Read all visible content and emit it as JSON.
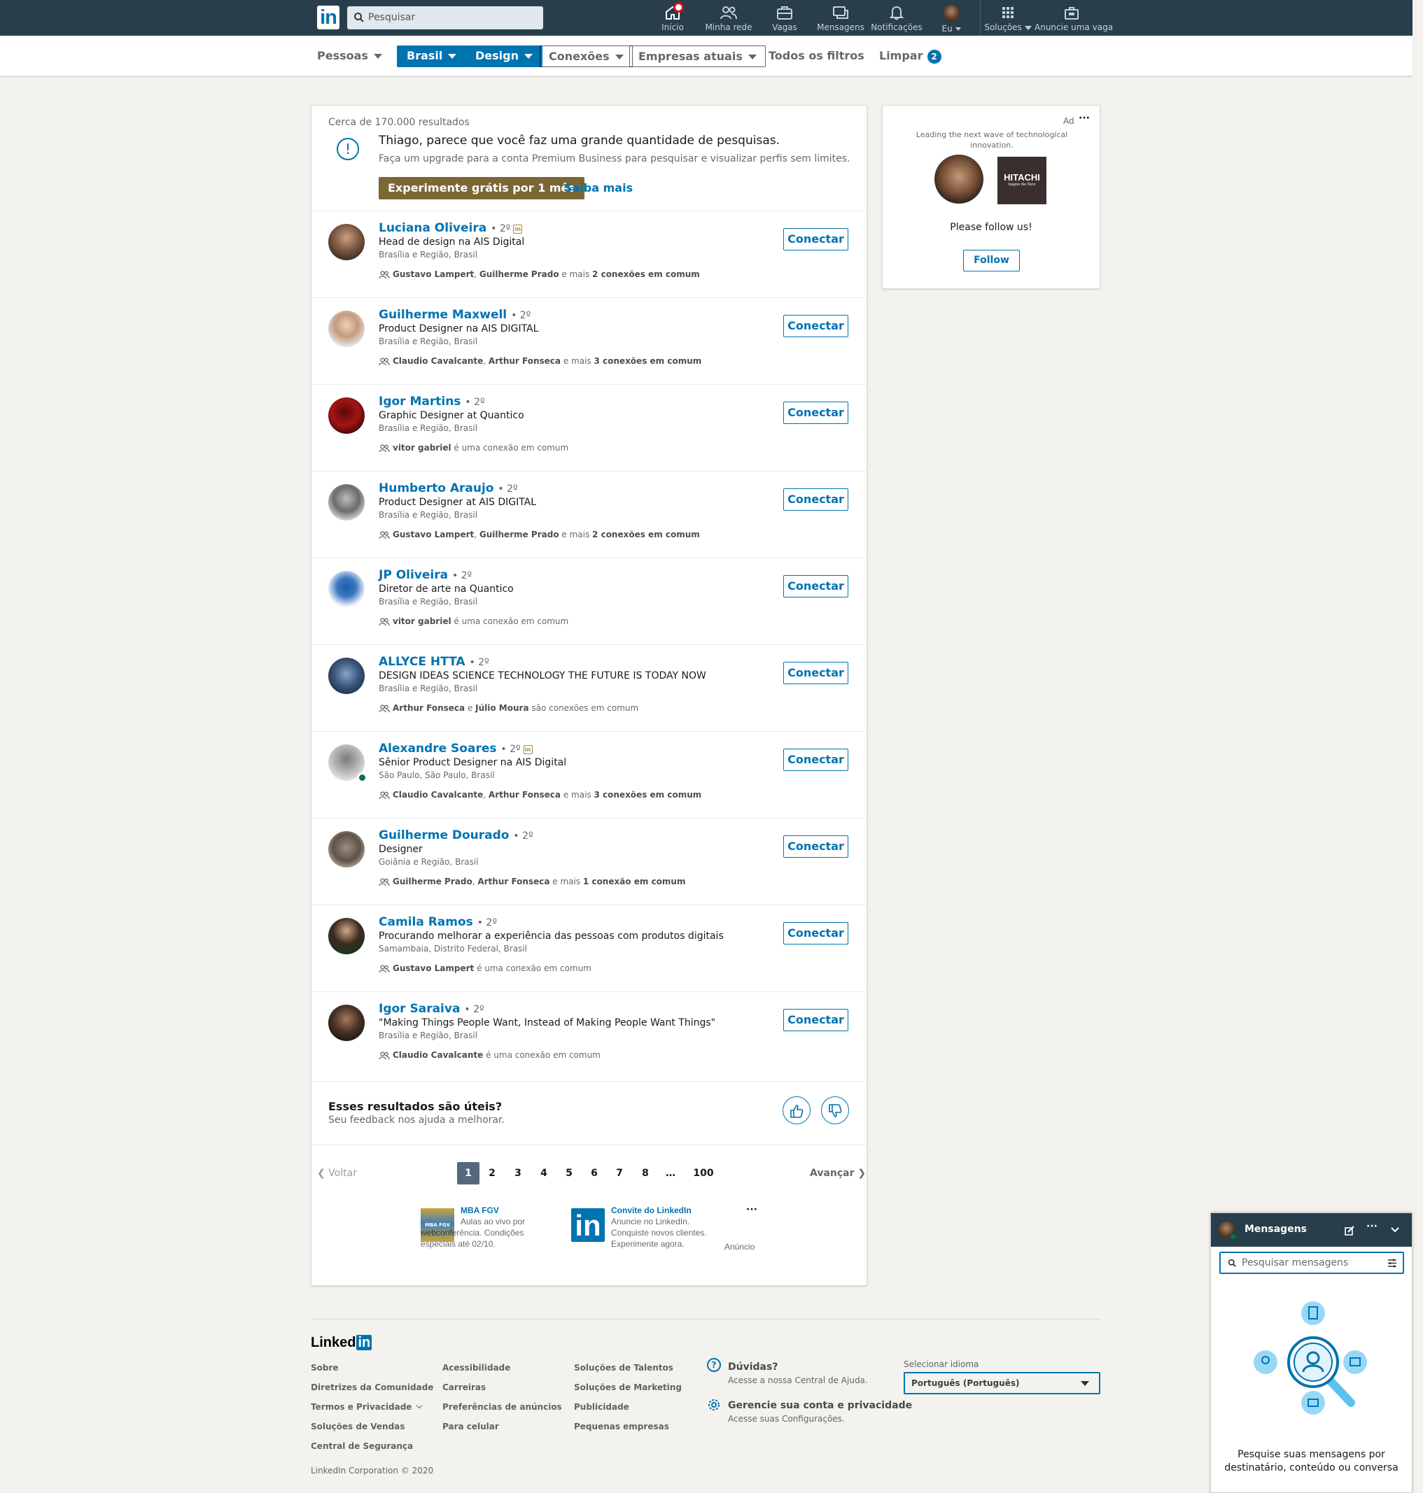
{
  "colors": {
    "nav": "#283e4a",
    "brand": "#0073b1",
    "premium": "#7a6734",
    "online": "#057642"
  },
  "nav": {
    "logo": "in",
    "search_placeholder": "Pesquisar",
    "items": [
      {
        "label": "Início",
        "icon": "home-icon"
      },
      {
        "label": "Minha rede",
        "icon": "network-icon"
      },
      {
        "label": "Vagas",
        "icon": "briefcase-icon"
      },
      {
        "label": "Mensagens",
        "icon": "messaging-icon"
      },
      {
        "label": "Notificações",
        "icon": "bell-icon"
      },
      {
        "label": "Eu",
        "icon": "avatar"
      },
      {
        "label": "Soluções",
        "icon": "grid-icon"
      },
      {
        "label": "Anuncie uma vaga",
        "icon": "post-job-icon"
      }
    ]
  },
  "filters": {
    "people": "Pessoas",
    "brasil": "Brasil",
    "design": "Design",
    "conexoes": "Conexões",
    "empresas": "Empresas atuais",
    "todos": "Todos os filtros",
    "limpar": "Limpar",
    "limpar_count": "2"
  },
  "results": {
    "count": "Cerca de 170.000 resultados",
    "upsell_title": "Thiago, parece que você faz uma grande quantidade de pesquisas.",
    "upsell_sub": "Faça um upgrade para a conta Premium Business para pesquisar e visualizar perfis sem limites.",
    "try_button": "Experimente grátis por 1 mês",
    "learn_more": "Saiba mais",
    "connect_label": "Conectar",
    "people": [
      {
        "name": "Luciana Oliveira",
        "degree": "• 2º",
        "premium": true,
        "headline": "Head de design na AIS Digital",
        "location": "Brasília e Região, Brasil",
        "shared_a": "Gustavo Lampert",
        "sep1": ", ",
        "shared_b": "Guilherme Prado",
        "mid": " e mais ",
        "shared_c": "2 conexões em comum",
        "tail": ""
      },
      {
        "name": "Guilherme Maxwell",
        "degree": "• 2º",
        "premium": false,
        "headline": "Product Designer na AIS DIGITAL",
        "location": "Brasília e Região, Brasil",
        "shared_a": "Claudio Cavalcante",
        "sep1": ", ",
        "shared_b": "Arthur Fonseca",
        "mid": " e mais ",
        "shared_c": "3 conexões em comum",
        "tail": ""
      },
      {
        "name": "Igor Martins",
        "degree": "• 2º",
        "premium": false,
        "headline": "Graphic Designer at Quantico",
        "location": "Brasília e Região, Brasil",
        "shared_a": "vitor gabriel",
        "sep1": "",
        "shared_b": "",
        "mid": "",
        "shared_c": "",
        "tail": " é uma conexão em comum"
      },
      {
        "name": "Humberto Araujo",
        "degree": "• 2º",
        "premium": false,
        "headline": "Product Designer at AIS DIGITAL",
        "location": "Brasília e Região, Brasil",
        "shared_a": "Gustavo Lampert",
        "sep1": ", ",
        "shared_b": "Guilherme Prado",
        "mid": " e mais ",
        "shared_c": "2 conexões em comum",
        "tail": ""
      },
      {
        "name": "JP Oliveira",
        "degree": "• 2º",
        "premium": false,
        "headline": "Diretor de arte na Quantico",
        "location": "Brasília e Região, Brasil",
        "shared_a": "vitor gabriel",
        "sep1": "",
        "shared_b": "",
        "mid": "",
        "shared_c": "",
        "tail": " é uma conexão em comum"
      },
      {
        "name": "ALLYCE HTTA",
        "degree": "• 2º",
        "premium": false,
        "headline": "DESIGN IDEAS SCIENCE TECHNOLOGY THE FUTURE IS TODAY NOW",
        "location": "Brasília e Região, Brasil",
        "shared_a": "Arthur Fonseca",
        "sep1": " e ",
        "shared_b": "Júlio Moura",
        "mid": "",
        "shared_c": "",
        "tail": " são conexões em comum"
      },
      {
        "name": "Alexandre Soares",
        "degree": "• 2º",
        "premium": true,
        "online": true,
        "headline": "Sênior Product Designer na AIS Digital",
        "location": "São Paulo, São Paulo, Brasil",
        "shared_a": "Claudio Cavalcante",
        "sep1": ", ",
        "shared_b": "Arthur Fonseca",
        "mid": " e mais ",
        "shared_c": "3 conexões em comum",
        "tail": ""
      },
      {
        "name": "Guilherme Dourado",
        "degree": "• 2º",
        "premium": false,
        "headline": "Designer",
        "location": "Goiânia e Região, Brasil",
        "shared_a": "Guilherme Prado",
        "sep1": ", ",
        "shared_b": "Arthur Fonseca",
        "mid": " e mais ",
        "shared_c": "1 conexão em comum",
        "tail": ""
      },
      {
        "name": "Camila Ramos",
        "degree": "• 2º",
        "premium": false,
        "headline": "Procurando melhorar a experiência das pessoas com produtos digitais",
        "location": "Samambaia, Distrito Federal, Brasil",
        "shared_a": "Gustavo Lampert",
        "sep1": "",
        "shared_b": "",
        "mid": "",
        "shared_c": "",
        "tail": " é uma conexão em comum"
      },
      {
        "name": "Igor Saraiva",
        "degree": "• 2º",
        "premium": false,
        "headline": "\"Making Things People Want, Instead of Making People Want Things\"",
        "location": "Brasília e Região, Brasil",
        "shared_a": "Claudio Cavalcante",
        "sep1": "",
        "shared_b": "",
        "mid": "",
        "shared_c": "",
        "tail": " é uma conexão em comum"
      }
    ],
    "feedback_title": "Esses resultados são úteis?",
    "feedback_sub": "Seu feedback nos ajuda a melhorar.",
    "pagination": {
      "prev": "Voltar",
      "next": "Avançar",
      "pages": [
        "1",
        "2",
        "3",
        "4",
        "5",
        "6",
        "7",
        "8",
        "…",
        "100"
      ],
      "current": "1"
    },
    "ads": {
      "a_title": "MBA FGV",
      "a_text": "Aulas ao vivo por webconferência. Condições especiais até 02/10.",
      "a_logo": "MBA FGV",
      "b_title": "Convite do LinkedIn",
      "b_text": "Anuncie no LinkedIn. Conquiste novos clientes. Experimente agora.",
      "b_logo": "in",
      "more": "···",
      "label": "Anúncio"
    }
  },
  "right_ad": {
    "ad_label": "Ad",
    "more": "···",
    "tagline": "Leading the next wave of technological innovation.",
    "brand_name": "HITACHI",
    "brand_slogan": "Inspire the Next",
    "prompt": "Please follow us!",
    "follow": "Follow"
  },
  "footer": {
    "logo_a": "Linked",
    "logo_b": "in",
    "col1": [
      "Sobre",
      "Diretrizes da Comunidade",
      "Termos e Privacidade",
      "Soluções de Vendas",
      "Central de Segurança"
    ],
    "col2": [
      "Acessibilidade",
      "Carreiras",
      "Preferências de anúncios",
      "Para celular"
    ],
    "col3": [
      "Soluções de Talentos",
      "Soluções de Marketing",
      "Publicidade",
      "Pequenas empresas"
    ],
    "help_title": "Dúvidas?",
    "help_sub": "Acesse a nossa Central de Ajuda.",
    "manage_title": "Gerencie sua conta e privacidade",
    "manage_sub": "Acesse suas Configurações.",
    "lang_label": "Selecionar idioma",
    "lang_value": "Português (Português)",
    "copyright": "LinkedIn Corporation © 2020"
  },
  "messaging": {
    "title": "Mensagens",
    "search_placeholder": "Pesquisar mensagens",
    "empty_text": "Pesquise suas mensagens por destinatário, conteúdo ou conversa",
    "more": "···"
  }
}
